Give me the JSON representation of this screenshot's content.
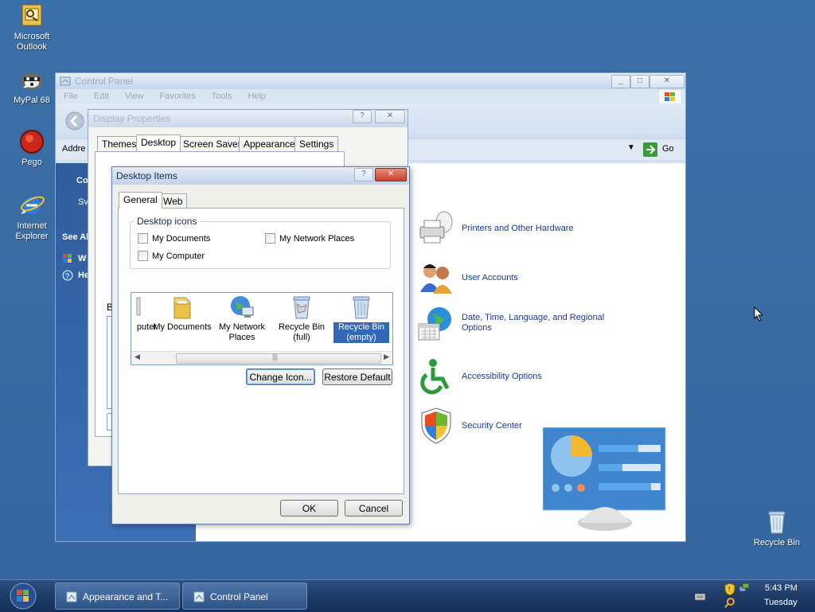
{
  "desktop": {
    "icons": [
      {
        "label": "Microsoft Outlook"
      },
      {
        "label": "MyPal 68"
      },
      {
        "label": "Pego"
      },
      {
        "label": "Internet Explorer"
      },
      {
        "label": "Recycle Bin"
      }
    ]
  },
  "control_panel": {
    "title": "Control Panel",
    "menu": [
      "File",
      "Edit",
      "View",
      "Favorites",
      "Tools",
      "Help"
    ],
    "address_label": "Addre",
    "go_label": "Go",
    "left_pane": {
      "section_fragment": "Co",
      "item_fragment": "Sv",
      "see_also": "See Al",
      "link1": "W",
      "link2": "He"
    },
    "categories": [
      {
        "label": "Printers and Other Hardware",
        "icon": "printer-icon"
      },
      {
        "label": "User Accounts",
        "icon": "users-icon"
      },
      {
        "label": "Date, Time, Language, and Regional Options",
        "icon": "date-time-globe-icon"
      },
      {
        "label": "Accessibility Options",
        "icon": "accessibility-icon"
      },
      {
        "label": "Security Center",
        "icon": "shield-icon"
      }
    ]
  },
  "display_properties": {
    "title": "Display Properties",
    "tabs": [
      "Themes",
      "Desktop",
      "Screen Saver",
      "Appearance",
      "Settings"
    ],
    "active_tab": "Desktop",
    "fragment": "B"
  },
  "desktop_items": {
    "title": "Desktop Items",
    "tabs": [
      "General",
      "Web"
    ],
    "active_tab": "General",
    "group_label": "Desktop icons",
    "checkboxes": [
      {
        "label": "My Documents",
        "checked": false
      },
      {
        "label": "My Network Places",
        "checked": false
      },
      {
        "label": "My Computer",
        "checked": false
      }
    ],
    "icon_list": [
      {
        "line1": "puter",
        "line2": ""
      },
      {
        "line1": "My Documents",
        "line2": ""
      },
      {
        "line1": "My Network",
        "line2": "Places"
      },
      {
        "line1": "Recycle Bin",
        "line2": "(full)"
      },
      {
        "line1": "Recycle Bin",
        "line2": "(empty)"
      }
    ],
    "selected_icon": "Recycle Bin (empty)",
    "change_icon_label": "Change Icon...",
    "restore_default_label": "Restore Default",
    "ok_label": "OK",
    "cancel_label": "Cancel"
  },
  "taskbar": {
    "buttons": [
      "Appearance and T...",
      "Control Panel"
    ],
    "time": "5:43 PM",
    "day": "Tuesday"
  },
  "colors": {
    "accent": "#3168b8",
    "taskbar": "#1d3b66",
    "desktop": "#3a6ea5",
    "link": "#1b3a8f"
  }
}
